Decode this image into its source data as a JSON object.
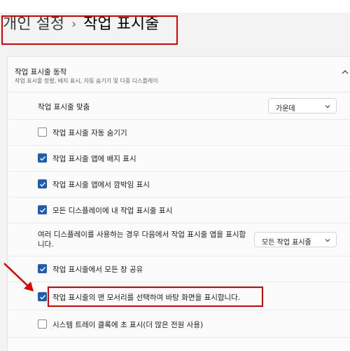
{
  "breadcrumb": {
    "parent": "개인 설정",
    "separator": "›",
    "current": "작업 표시줄"
  },
  "section": {
    "title": "작업 표시줄 동작",
    "subtitle": "작업 표시줄 정렬, 배지 표시, 자동 숨기기 및 다중 디스플레이"
  },
  "alignment": {
    "label": "작업 표시줄 맞춤",
    "value": "가운데"
  },
  "checkboxes": [
    {
      "label": "작업 표시줄 자동 숨기기",
      "checked": false
    },
    {
      "label": "작업 표시줄 앱에 배지 표시",
      "checked": true
    },
    {
      "label": "작업 표시줄 앱에서 깜박임 표시",
      "checked": true
    },
    {
      "label": "모든 디스플레이에 내 작업 표시줄 표시",
      "checked": true
    }
  ],
  "multi_display": {
    "label": "여러 디스플레이를 사용하는 경우 다음에서 작업 표시줄 앱을 표시합니다.",
    "value": "모든 작업 표시줄"
  },
  "checkboxes_bottom": [
    {
      "label": "작업 표시줄에서 모든 창 공유",
      "checked": true
    },
    {
      "label": "작업 표시줄의 맨 모서리를 선택하여 바탕 화면을 표시합니다.",
      "checked": true
    },
    {
      "label": "시스템 트레이 클록에 초 표시(더 많은 전원 사용)",
      "checked": false
    }
  ],
  "colors": {
    "accent": "#1a5fb4",
    "highlight": "#e00000"
  }
}
